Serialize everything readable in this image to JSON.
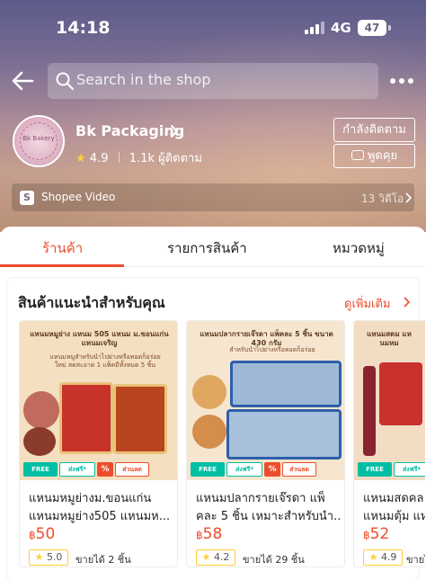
{
  "status_bar": {
    "time": "14:18",
    "network": "4G",
    "battery": "47"
  },
  "search": {
    "placeholder": "Search in the shop"
  },
  "shop": {
    "name": "Bk Packaging",
    "rating": "4.9",
    "followers": "1.1k ผู้ติดตาม",
    "avatar_text": "Bk Bakery",
    "follow_label": "กำลังติดตาม",
    "chat_label": "พูดคุย"
  },
  "video": {
    "label": "Shopee Video",
    "count": "13 วิดีโอ"
  },
  "tabs": [
    {
      "label": "ร้านค้า",
      "active": true
    },
    {
      "label": "รายการสินค้า",
      "active": false
    },
    {
      "label": "หมวดหมู่",
      "active": false
    }
  ],
  "section": {
    "title": "สินค้าแนะนำสำหรับคุณ",
    "see_more": "ดูเพิ่มเติม"
  },
  "badges": {
    "free": "FREE",
    "ship": "ส่งฟรี*",
    "discount": "ส่วนลด"
  },
  "products": [
    {
      "name_line1": "แหนมหมูย่างม.ขอนแก่น",
      "name_line2": "แหนมหมูย่าง505 แหนมห...",
      "currency": "฿",
      "price": "50",
      "rating": "5.0",
      "sold": "ขายได้ 2 ชิ้น",
      "img_headline": "แหนมหมูย่าง แหนม 505 แหนม ม.ขอนแก่น แหนมเจริญ",
      "img_sub": "แหนมหมูสำหรับนำไปย่างหรือทอดก็อร่อย ใหม่ สดสะอาด 1 แพ็คมีทั้งหมด 5 ชิ้น"
    },
    {
      "name_line1": "แหนมปลากรายเจ๊รดา แพ็",
      "name_line2": "คละ 5 ชิ้น เหมาะสำหรับนำ...",
      "currency": "฿",
      "price": "58",
      "rating": "4.2",
      "sold": "ขายได้ 29 ชิ้น",
      "img_headline": "แหนมปลากรายเจ๊รดา แพ็คละ 5 ชิ้น ขนาด 430 กรัม",
      "img_sub": "สำหรับนำไปย่างหรือทอดก็อร่อย"
    },
    {
      "name_line1": "แหนมสดคล",
      "name_line2": "แหนมตุ้ม แหน",
      "currency": "฿",
      "price": "52",
      "rating": "4.9",
      "sold": "ขายได้",
      "img_headline": "แหนมสดม แหนมหม",
      "img_sub": ""
    }
  ],
  "colors": {
    "accent": "#ee4d2d",
    "star": "#ffce3d",
    "free_ship": "#00bfa5"
  },
  "icons": [
    "back-arrow-icon",
    "search-icon",
    "more-icon",
    "chevron-right-icon",
    "star-icon",
    "chat-icon",
    "video-icon"
  ]
}
